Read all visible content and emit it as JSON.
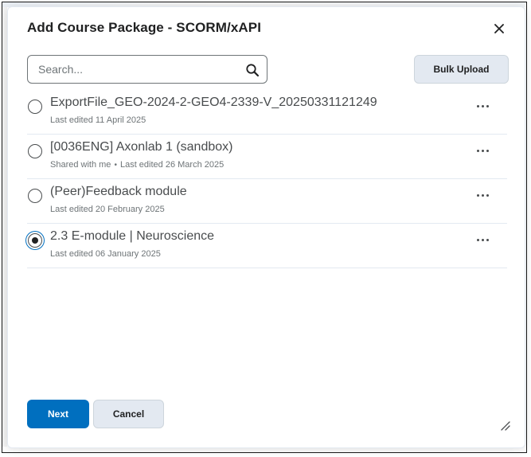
{
  "dialog": {
    "title": "Add Course Package - SCORM/xAPI",
    "close_icon": "close-icon"
  },
  "search": {
    "placeholder": "Search...",
    "value": "",
    "icon": "search-icon"
  },
  "bulk_upload_label": "Bulk Upload",
  "packages": [
    {
      "name": "ExportFile_GEO-2024-2-GEO4-2339-V_20250331121249",
      "shared": "",
      "meta": "Last edited 11 April 2025",
      "selected": false
    },
    {
      "name": "[0036ENG] Axonlab 1 (sandbox)",
      "shared": "Shared with me",
      "meta": "Last edited 26 March 2025",
      "selected": false
    },
    {
      "name": "(Peer)Feedback module",
      "shared": "",
      "meta": "Last edited 20 February 2025",
      "selected": false
    },
    {
      "name": "2.3 E-module | Neuroscience",
      "shared": "",
      "meta": "Last edited 06 January 2025",
      "selected": true
    }
  ],
  "footer": {
    "next_label": "Next",
    "cancel_label": "Cancel"
  },
  "colors": {
    "primary": "#006fbf",
    "secondary_button": "#e3e9f1",
    "divider": "#e3e9f1",
    "text": "#202122",
    "muted_text": "#6e7477"
  }
}
